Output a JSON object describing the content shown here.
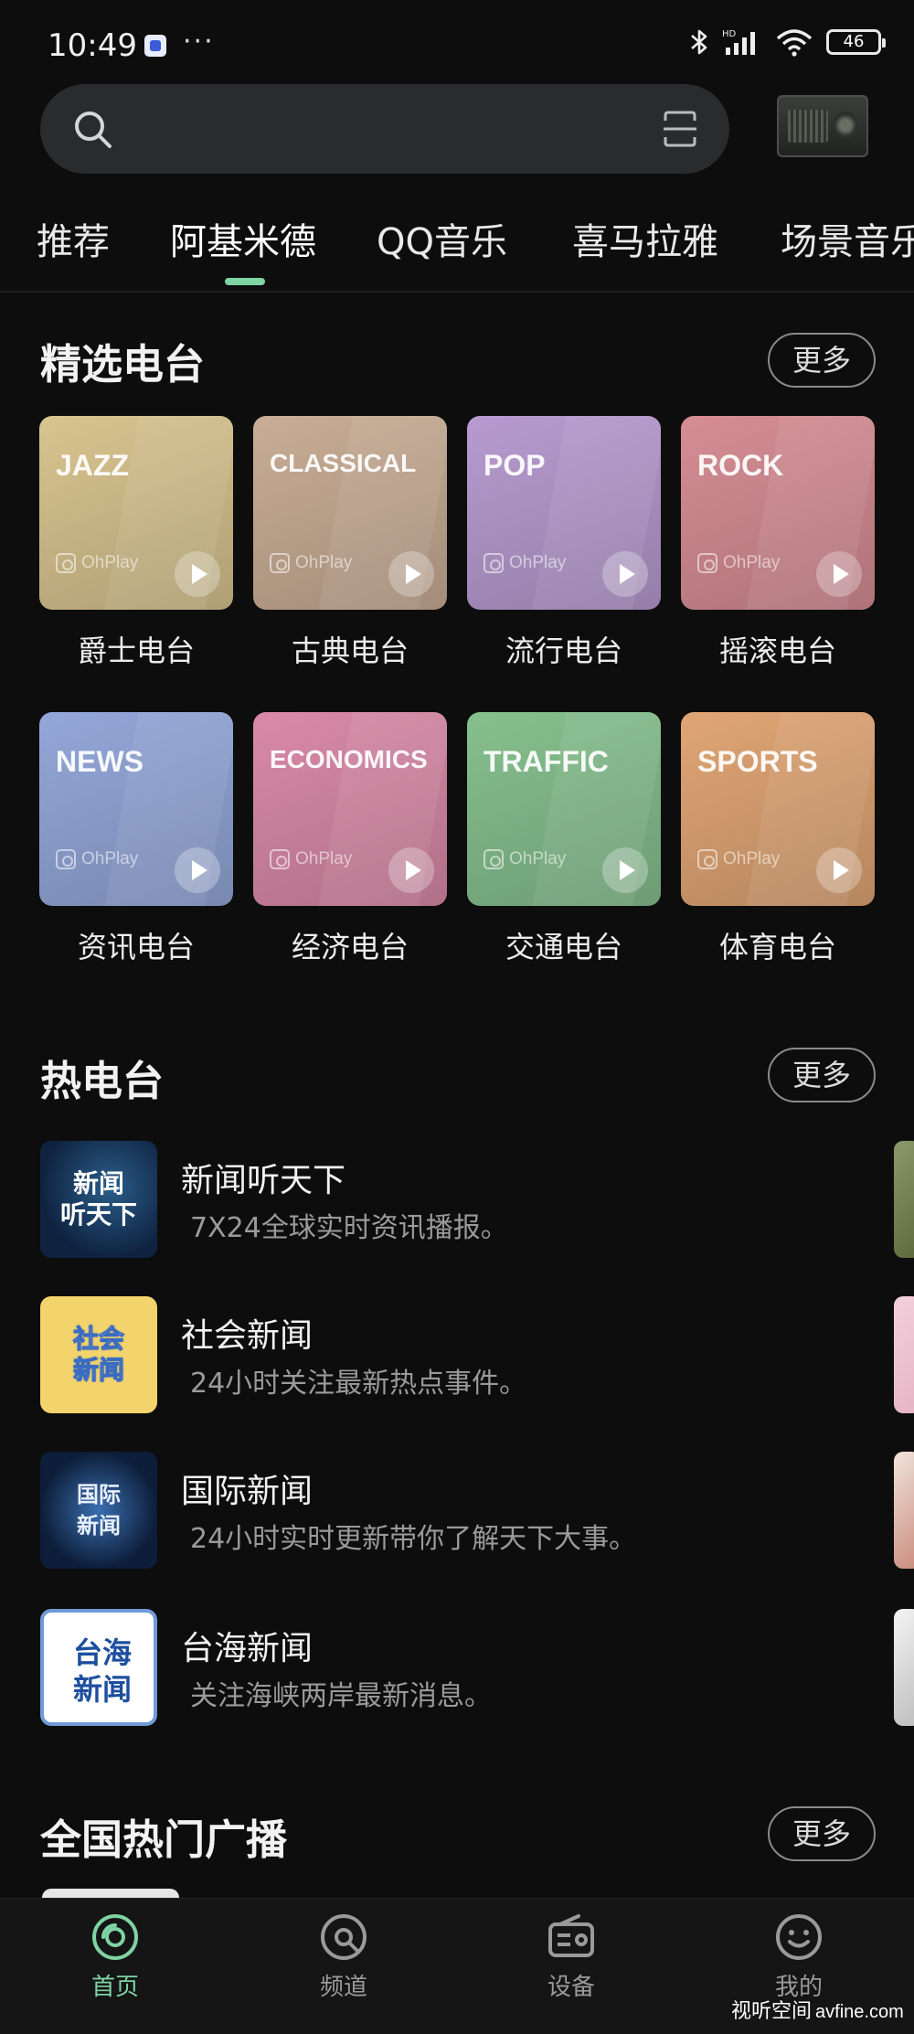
{
  "status_bar": {
    "time": "10:49",
    "dots": "···",
    "battery": "46"
  },
  "tabs": [
    "推荐",
    "阿基米德",
    "QQ音乐",
    "喜马拉雅",
    "场景音乐"
  ],
  "featured": {
    "title": "精选电台",
    "more": "更多",
    "brand": "OhPlay",
    "cards": [
      {
        "genre": "JAZZ",
        "caption": "爵士电台",
        "color": "#d8c48f"
      },
      {
        "genre": "CLASSICAL",
        "caption": "古典电台",
        "color": "#c9ad95"
      },
      {
        "genre": "POP",
        "caption": "流行电台",
        "color": "#b79bd0"
      },
      {
        "genre": "ROCK",
        "caption": "摇滚电台",
        "color": "#d68d94"
      },
      {
        "genre": "NEWS",
        "caption": "资讯电台",
        "color": "#93a7d9"
      },
      {
        "genre": "ECONOMICS",
        "caption": "经济电台",
        "color": "#d98aa6"
      },
      {
        "genre": "TRAFFIC",
        "caption": "交通电台",
        "color": "#86c08e"
      },
      {
        "genre": "SPORTS",
        "caption": "体育电台",
        "color": "#e0a574"
      }
    ]
  },
  "hot": {
    "title": "热电台",
    "more": "更多",
    "items": [
      {
        "title": "新闻听天下",
        "desc": "7X24全球实时资讯播报。",
        "thumb_line1": "新闻",
        "thumb_line2": "听天下"
      },
      {
        "title": "社会新闻",
        "desc": "24小时关注最新热点事件。",
        "thumb_line1": "社会",
        "thumb_line2": "新闻"
      },
      {
        "title": "国际新闻",
        "desc": "24小时实时更新带你了解天下大事。",
        "thumb_line1": "国际",
        "thumb_line2": "新闻"
      },
      {
        "title": "台海新闻",
        "desc": "关注海峡两岸最新消息。",
        "thumb_line1": "台海",
        "thumb_line2": "新闻"
      }
    ]
  },
  "national": {
    "title": "全国热门广播",
    "more": "更多"
  },
  "nav": [
    {
      "label": "首页",
      "icon": "home-disc-icon",
      "active": true
    },
    {
      "label": "频道",
      "icon": "channel-disc-icon",
      "active": false
    },
    {
      "label": "设备",
      "icon": "radio-device-icon",
      "active": false
    },
    {
      "label": "我的",
      "icon": "smiley-icon",
      "active": false
    }
  ],
  "watermark": {
    "site": "视听空间",
    "domain": "avfine.com"
  },
  "colors": {
    "accent": "#7ed3a3",
    "background": "#0d0d0d"
  }
}
